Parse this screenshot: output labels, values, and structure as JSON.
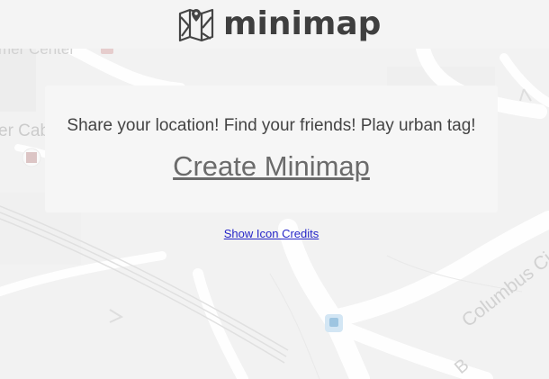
{
  "header": {
    "title": "minimap",
    "logo_icon": "folded-map-icon"
  },
  "map": {
    "labels": {
      "top_left": "mer Center",
      "left": "er Cab",
      "columbus_street": "Columbus Ci",
      "bottom_right": "B"
    },
    "colors": {
      "land": "#ececec",
      "road": "#ffffff",
      "overlay": "#fafafa"
    }
  },
  "card": {
    "tagline": "Share your location! Find your friends! Play urban tag!",
    "create_label": "Create Minimap"
  },
  "footer": {
    "credits_label": "Show Icon Credits"
  }
}
